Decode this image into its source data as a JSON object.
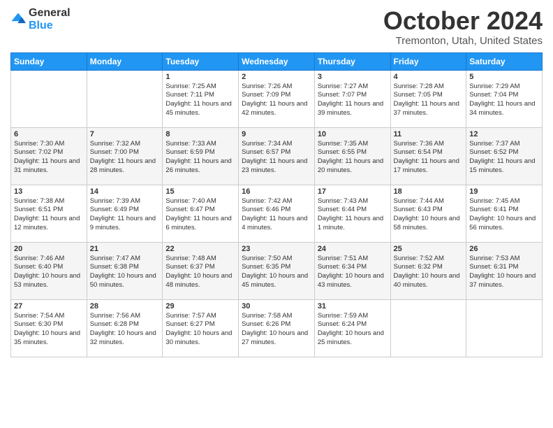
{
  "logo": {
    "general": "General",
    "blue": "Blue"
  },
  "header": {
    "month": "October 2024",
    "location": "Tremonton, Utah, United States"
  },
  "days_of_week": [
    "Sunday",
    "Monday",
    "Tuesday",
    "Wednesday",
    "Thursday",
    "Friday",
    "Saturday"
  ],
  "weeks": [
    [
      {
        "day": "",
        "text": ""
      },
      {
        "day": "",
        "text": ""
      },
      {
        "day": "1",
        "text": "Sunrise: 7:25 AM\nSunset: 7:11 PM\nDaylight: 11 hours and 45 minutes."
      },
      {
        "day": "2",
        "text": "Sunrise: 7:26 AM\nSunset: 7:09 PM\nDaylight: 11 hours and 42 minutes."
      },
      {
        "day": "3",
        "text": "Sunrise: 7:27 AM\nSunset: 7:07 PM\nDaylight: 11 hours and 39 minutes."
      },
      {
        "day": "4",
        "text": "Sunrise: 7:28 AM\nSunset: 7:05 PM\nDaylight: 11 hours and 37 minutes."
      },
      {
        "day": "5",
        "text": "Sunrise: 7:29 AM\nSunset: 7:04 PM\nDaylight: 11 hours and 34 minutes."
      }
    ],
    [
      {
        "day": "6",
        "text": "Sunrise: 7:30 AM\nSunset: 7:02 PM\nDaylight: 11 hours and 31 minutes."
      },
      {
        "day": "7",
        "text": "Sunrise: 7:32 AM\nSunset: 7:00 PM\nDaylight: 11 hours and 28 minutes."
      },
      {
        "day": "8",
        "text": "Sunrise: 7:33 AM\nSunset: 6:59 PM\nDaylight: 11 hours and 26 minutes."
      },
      {
        "day": "9",
        "text": "Sunrise: 7:34 AM\nSunset: 6:57 PM\nDaylight: 11 hours and 23 minutes."
      },
      {
        "day": "10",
        "text": "Sunrise: 7:35 AM\nSunset: 6:55 PM\nDaylight: 11 hours and 20 minutes."
      },
      {
        "day": "11",
        "text": "Sunrise: 7:36 AM\nSunset: 6:54 PM\nDaylight: 11 hours and 17 minutes."
      },
      {
        "day": "12",
        "text": "Sunrise: 7:37 AM\nSunset: 6:52 PM\nDaylight: 11 hours and 15 minutes."
      }
    ],
    [
      {
        "day": "13",
        "text": "Sunrise: 7:38 AM\nSunset: 6:51 PM\nDaylight: 11 hours and 12 minutes."
      },
      {
        "day": "14",
        "text": "Sunrise: 7:39 AM\nSunset: 6:49 PM\nDaylight: 11 hours and 9 minutes."
      },
      {
        "day": "15",
        "text": "Sunrise: 7:40 AM\nSunset: 6:47 PM\nDaylight: 11 hours and 6 minutes."
      },
      {
        "day": "16",
        "text": "Sunrise: 7:42 AM\nSunset: 6:46 PM\nDaylight: 11 hours and 4 minutes."
      },
      {
        "day": "17",
        "text": "Sunrise: 7:43 AM\nSunset: 6:44 PM\nDaylight: 11 hours and 1 minute."
      },
      {
        "day": "18",
        "text": "Sunrise: 7:44 AM\nSunset: 6:43 PM\nDaylight: 10 hours and 58 minutes."
      },
      {
        "day": "19",
        "text": "Sunrise: 7:45 AM\nSunset: 6:41 PM\nDaylight: 10 hours and 56 minutes."
      }
    ],
    [
      {
        "day": "20",
        "text": "Sunrise: 7:46 AM\nSunset: 6:40 PM\nDaylight: 10 hours and 53 minutes."
      },
      {
        "day": "21",
        "text": "Sunrise: 7:47 AM\nSunset: 6:38 PM\nDaylight: 10 hours and 50 minutes."
      },
      {
        "day": "22",
        "text": "Sunrise: 7:48 AM\nSunset: 6:37 PM\nDaylight: 10 hours and 48 minutes."
      },
      {
        "day": "23",
        "text": "Sunrise: 7:50 AM\nSunset: 6:35 PM\nDaylight: 10 hours and 45 minutes."
      },
      {
        "day": "24",
        "text": "Sunrise: 7:51 AM\nSunset: 6:34 PM\nDaylight: 10 hours and 43 minutes."
      },
      {
        "day": "25",
        "text": "Sunrise: 7:52 AM\nSunset: 6:32 PM\nDaylight: 10 hours and 40 minutes."
      },
      {
        "day": "26",
        "text": "Sunrise: 7:53 AM\nSunset: 6:31 PM\nDaylight: 10 hours and 37 minutes."
      }
    ],
    [
      {
        "day": "27",
        "text": "Sunrise: 7:54 AM\nSunset: 6:30 PM\nDaylight: 10 hours and 35 minutes."
      },
      {
        "day": "28",
        "text": "Sunrise: 7:56 AM\nSunset: 6:28 PM\nDaylight: 10 hours and 32 minutes."
      },
      {
        "day": "29",
        "text": "Sunrise: 7:57 AM\nSunset: 6:27 PM\nDaylight: 10 hours and 30 minutes."
      },
      {
        "day": "30",
        "text": "Sunrise: 7:58 AM\nSunset: 6:26 PM\nDaylight: 10 hours and 27 minutes."
      },
      {
        "day": "31",
        "text": "Sunrise: 7:59 AM\nSunset: 6:24 PM\nDaylight: 10 hours and 25 minutes."
      },
      {
        "day": "",
        "text": ""
      },
      {
        "day": "",
        "text": ""
      }
    ]
  ]
}
